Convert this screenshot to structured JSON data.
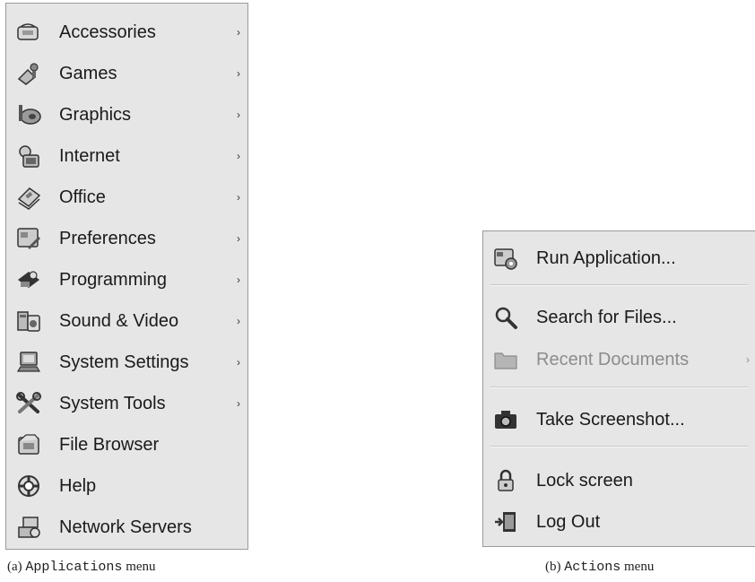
{
  "applications_menu": {
    "items": [
      {
        "label": "Accessories",
        "icon": "accessories-icon",
        "submenu": true
      },
      {
        "label": "Games",
        "icon": "games-icon",
        "submenu": true
      },
      {
        "label": "Graphics",
        "icon": "graphics-icon",
        "submenu": true
      },
      {
        "label": "Internet",
        "icon": "internet-icon",
        "submenu": true
      },
      {
        "label": "Office",
        "icon": "office-icon",
        "submenu": true
      },
      {
        "label": "Preferences",
        "icon": "preferences-icon",
        "submenu": true
      },
      {
        "label": "Programming",
        "icon": "programming-icon",
        "submenu": true
      },
      {
        "label": "Sound & Video",
        "icon": "sound-video-icon",
        "submenu": true
      },
      {
        "label": "System Settings",
        "icon": "system-settings-icon",
        "submenu": true
      },
      {
        "label": "System Tools",
        "icon": "system-tools-icon",
        "submenu": true
      },
      {
        "label": "File Browser",
        "icon": "file-browser-icon",
        "submenu": false
      },
      {
        "label": "Help",
        "icon": "help-icon",
        "submenu": false
      },
      {
        "label": "Network Servers",
        "icon": "network-servers-icon",
        "submenu": false
      }
    ],
    "submenu_arrow": "›"
  },
  "actions_menu": {
    "items": [
      {
        "label": "Run Application...",
        "icon": "run-application-icon",
        "submenu": false,
        "disabled": false
      },
      {
        "label": "Search for Files...",
        "icon": "search-icon",
        "submenu": false,
        "disabled": false
      },
      {
        "label": "Recent Documents",
        "icon": "folder-icon",
        "submenu": true,
        "disabled": true
      },
      {
        "label": "Take Screenshot...",
        "icon": "camera-icon",
        "submenu": false,
        "disabled": false
      },
      {
        "label": "Lock screen",
        "icon": "lock-icon",
        "submenu": false,
        "disabled": false
      },
      {
        "label": "Log Out",
        "icon": "log-out-icon",
        "submenu": false,
        "disabled": false
      }
    ],
    "submenu_arrow": "›"
  },
  "captions": {
    "a_prefix": "(a)",
    "a_name": "Applications",
    "a_suffix": "menu",
    "b_prefix": "(b)",
    "b_name": "Actions",
    "b_suffix": "menu"
  },
  "colors": {
    "menu_background": "#e6e6e6",
    "menu_border": "#9a9a9a",
    "text": "#1a1a1a",
    "disabled_text": "#8c8c8c"
  }
}
